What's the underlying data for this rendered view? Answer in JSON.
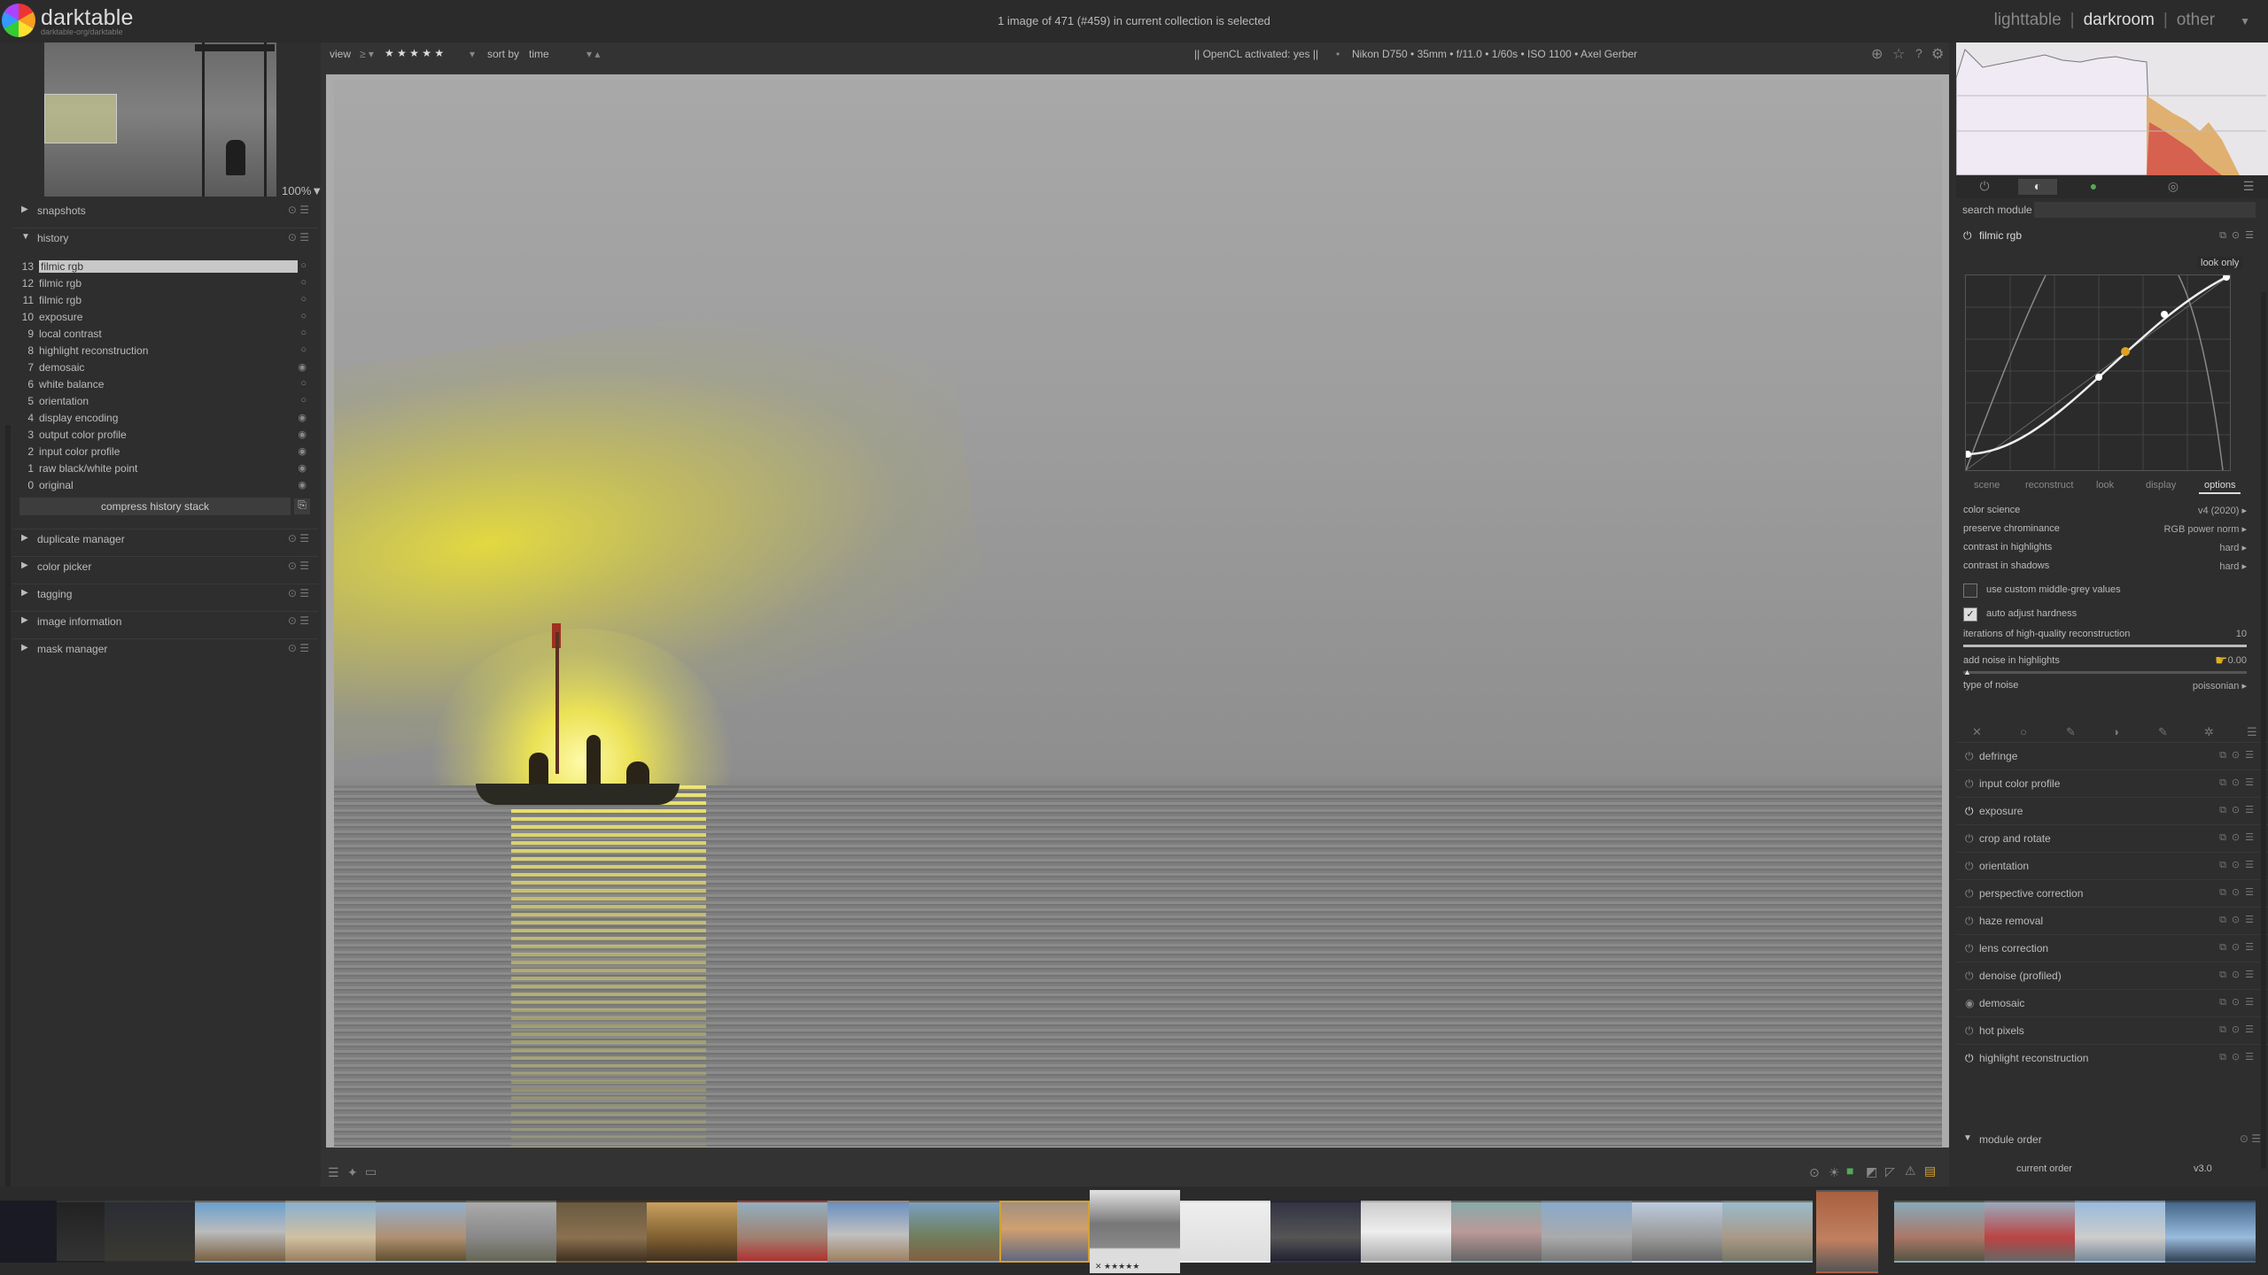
{
  "app": {
    "name": "darktable",
    "subtitle": "darktable-org/darktable",
    "collection_status": "1 image of 471 (#459) in current collection is selected",
    "views": [
      "lighttable",
      "darkroom",
      "other"
    ],
    "active_view": "darkroom"
  },
  "navigation": {
    "zoom": "100%▼"
  },
  "left_panel": {
    "snapshots": "snapshots",
    "history": "history",
    "history_items": [
      {
        "n": "13",
        "label": "filmic rgb"
      },
      {
        "n": "12",
        "label": "filmic rgb"
      },
      {
        "n": "11",
        "label": "filmic rgb"
      },
      {
        "n": "10",
        "label": "exposure"
      },
      {
        "n": "9",
        "label": "local contrast"
      },
      {
        "n": "8",
        "label": "highlight reconstruction"
      },
      {
        "n": "7",
        "label": "demosaic"
      },
      {
        "n": "6",
        "label": "white balance"
      },
      {
        "n": "5",
        "label": "orientation"
      },
      {
        "n": "4",
        "label": "display encoding"
      },
      {
        "n": "3",
        "label": "output color profile"
      },
      {
        "n": "2",
        "label": "input color profile"
      },
      {
        "n": "1",
        "label": "raw black/white point"
      },
      {
        "n": "0",
        "label": "original"
      }
    ],
    "compress": "compress history stack",
    "sections": [
      "duplicate manager",
      "color picker",
      "tagging",
      "image information",
      "mask manager"
    ]
  },
  "center_toolbar": {
    "view_label": "view",
    "view_filter": "≥ ▾",
    "stars": "★ ★ ★ ★ ★",
    "sort_label": "sort by",
    "sort_value": "time",
    "sort_dir": "▾  ▴",
    "opencl": "|| OpenCL activated: yes ||",
    "exif": "Nikon D750 • 35mm • f/11.0 • 1/60s • ISO 1100 • Axel Gerber"
  },
  "right_panel": {
    "search_label": "search module",
    "module_title": "filmic rgb",
    "look_only": "look only",
    "tabs": [
      "scene",
      "reconstruct",
      "look",
      "display",
      "options"
    ],
    "active_tab": "options",
    "options": [
      {
        "label": "color science",
        "value": "v4 (2020)"
      },
      {
        "label": "preserve chrominance",
        "value": "RGB power norm"
      },
      {
        "label": "contrast in highlights",
        "value": "hard"
      },
      {
        "label": "contrast in shadows",
        "value": "hard"
      }
    ],
    "checkbox_custom_grey": "use custom middle-grey values",
    "checkbox_auto_hardness": "auto adjust hardness",
    "iterations_label": "iterations of high-quality reconstruction",
    "iterations_value": "10",
    "iterations_fraction": 1.0,
    "noise_label": "add noise in highlights",
    "noise_value": "0.00",
    "noise_fraction": 0.0,
    "noise_type_label": "type of noise",
    "noise_type_value": "poissonian",
    "modules": [
      "defringe",
      "input color profile",
      "exposure",
      "crop and rotate",
      "orientation",
      "perspective correction",
      "haze removal",
      "lens correction",
      "denoise (profiled)",
      "demosaic",
      "hot pixels",
      "highlight reconstruction"
    ],
    "module_order_label": "module order",
    "current_order_label": "current order",
    "current_order_value": "v3.0"
  },
  "colors": {
    "accent_selected": "#d4a030",
    "sun_yellow": "#f0e040",
    "panel_bg": "#2e2e2e"
  }
}
